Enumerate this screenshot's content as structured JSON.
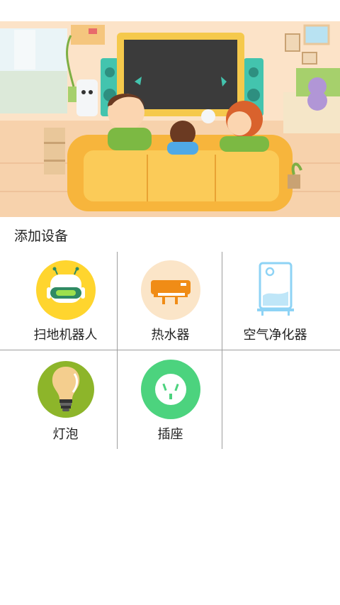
{
  "section": {
    "title": "添加设备"
  },
  "devices": [
    {
      "label": "扫地机器人",
      "icon": "robot-vacuum-icon",
      "color": "#FFD52E"
    },
    {
      "label": "热水器",
      "icon": "water-heater-icon",
      "color": "#FBE5C8"
    },
    {
      "label": "空气净化器",
      "icon": "air-purifier-icon",
      "color": "#8ED3F5"
    },
    {
      "label": "灯泡",
      "icon": "light-bulb-icon",
      "color": "#8DB52A"
    },
    {
      "label": "插座",
      "icon": "socket-icon",
      "color": "#4CD37E"
    }
  ],
  "colors": {
    "divider": "#9e9e9e",
    "background": "#ffffff"
  }
}
